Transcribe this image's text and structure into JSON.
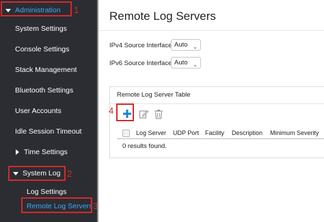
{
  "sidebar": {
    "items": [
      {
        "label": "Administration"
      },
      {
        "label": "System Settings"
      },
      {
        "label": "Console Settings"
      },
      {
        "label": "Stack Management"
      },
      {
        "label": "Bluetooth Settings"
      },
      {
        "label": "User Accounts"
      },
      {
        "label": "Idle Session Timeout"
      },
      {
        "label": "Time Settings"
      },
      {
        "label": "System Log"
      },
      {
        "label": "Log Settings"
      },
      {
        "label": "Remote Log Servers"
      }
    ]
  },
  "annotations": {
    "n1": "1",
    "n2": "2",
    "n3": "3",
    "n4": "4"
  },
  "main": {
    "title": "Remote Log Servers",
    "ipv4_label": "IPv4 Source Interface:",
    "ipv4_value": "Auto",
    "ipv6_label": "IPv6 Source Interface:",
    "ipv6_value": "Auto",
    "table": {
      "title": "Remote Log Server Table",
      "columns": [
        "Log Server",
        "UDP Port",
        "Facility",
        "Description",
        "Minimum Severity"
      ],
      "empty_text": "0 results found."
    }
  },
  "icons": {
    "add": "plus-icon",
    "edit": "edit-icon",
    "delete": "trash-icon"
  },
  "colors": {
    "sidebar_bg": "#2b2d33",
    "active_text": "#3fa9f5",
    "annotation_red": "#d32a2a",
    "add_icon": "#1e7fd6"
  }
}
